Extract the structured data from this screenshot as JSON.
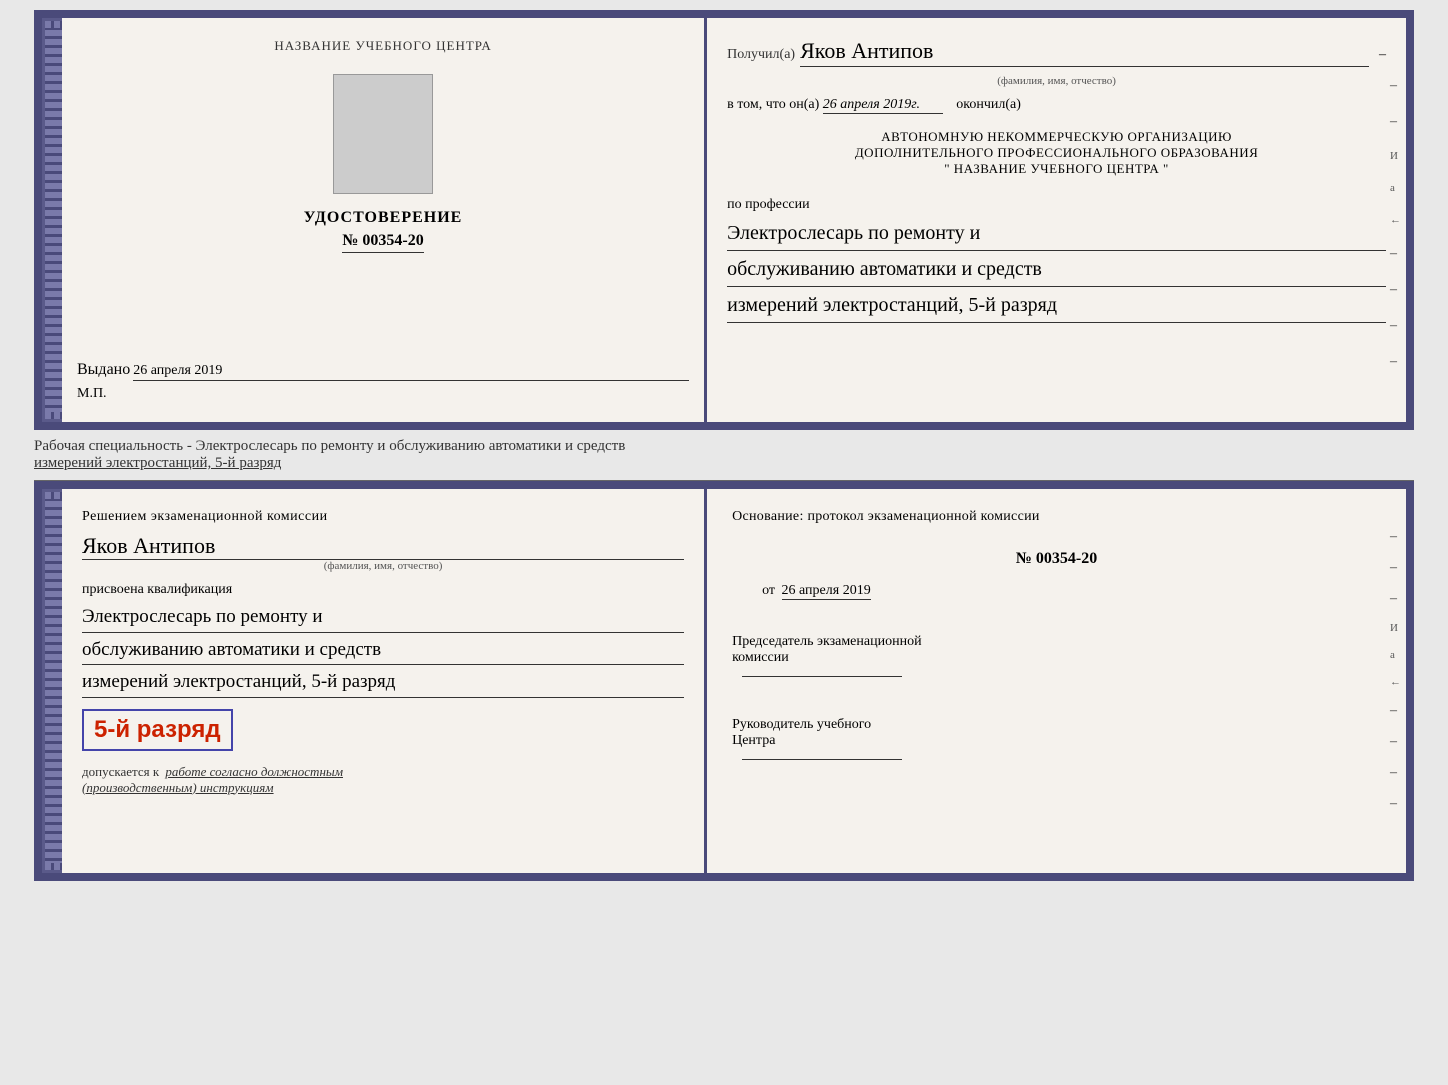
{
  "top_booklet": {
    "left": {
      "center_title": "НАЗВАНИЕ УЧЕБНОГО ЦЕНТРА",
      "cert_title": "УДОСТОВЕРЕНИЕ",
      "cert_number": "№ 00354-20",
      "issued_label": "Выдано",
      "issued_date": "26 апреля 2019",
      "mp": "М.П."
    },
    "right": {
      "received_label": "Получил(а)",
      "recipient_name": "Яков Антипов",
      "fio_sub": "(фамилия, имя, отчество)",
      "in_that_label": "в том, что он(а)",
      "in_that_date": "26 апреля 2019г.",
      "finished_label": "окончил(а)",
      "org_line1": "АВТОНОМНУЮ НЕКОММЕРЧЕСКУЮ ОРГАНИЗАЦИЮ",
      "org_line2": "ДОПОЛНИТЕЛЬНОГО ПРОФЕССИОНАЛЬНОГО ОБРАЗОВАНИЯ",
      "org_line3": "\"   НАЗВАНИЕ УЧЕБНОГО ЦЕНТРА   \"",
      "profession_label": "по профессии",
      "profession_line1": "Электрослесарь по ремонту и",
      "profession_line2": "обслуживанию автоматики и средств",
      "profession_line3": "измерений электростанций, 5-й разряд"
    }
  },
  "caption": "Рабочая специальность - Электрослесарь по ремонту и обслуживанию автоматики и средств\nизмерений электростанций, 5-й разряд",
  "bottom_booklet": {
    "left": {
      "decision_label": "Решением экзаменационной комиссии",
      "person_name": "Яков Антипов",
      "fio_sub": "(фамилия, имя, отчество)",
      "qualification_label": "присвоена квалификация",
      "qual_line1": "Электрослесарь по ремонту и",
      "qual_line2": "обслуживанию автоматики и средств",
      "qual_line3": "измерений электростанций, 5-й разряд",
      "grade_text": "5-й разряд",
      "allowed_label": "допускается к",
      "allowed_text": "работе согласно должностным",
      "allowed_text2": "(производственным) инструкциям"
    },
    "right": {
      "basis_label": "Основание: протокол экзаменационной комиссии",
      "protocol_number": "№  00354-20",
      "date_from_label": "от",
      "date_from": "26 апреля 2019",
      "chairman_label": "Председатель экзаменационной",
      "chairman_label2": "комиссии",
      "head_label": "Руководитель учебного",
      "head_label2": "Центра"
    }
  }
}
